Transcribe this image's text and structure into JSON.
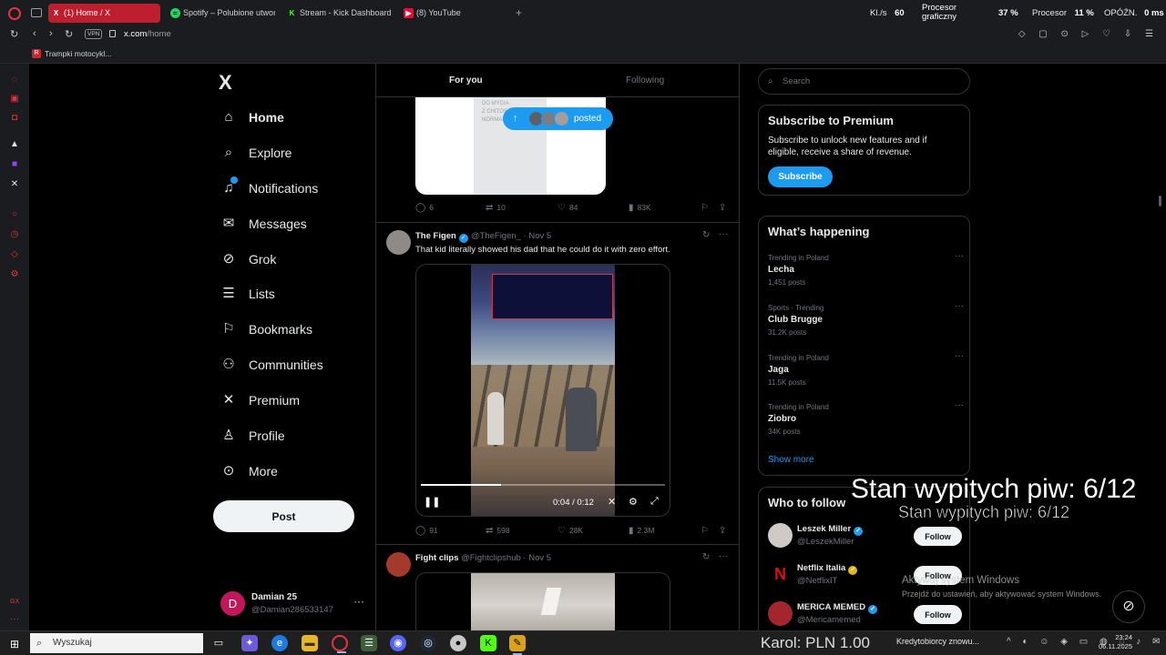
{
  "browser": {
    "tabs": [
      {
        "label": "(1) Home / X",
        "icon": "x-favicon",
        "active": true
      },
      {
        "label": "Spotify – Polubione utwory",
        "icon": "spotify-favicon",
        "active": false
      },
      {
        "label": "Stream - Kick Dashboard",
        "icon": "kick-favicon",
        "active": false
      },
      {
        "label": "(8) YouTube",
        "icon": "youtube-favicon",
        "active": false
      }
    ],
    "sys_stats": {
      "kls_label": "Kl./s",
      "kls_value": "60",
      "gpu_label_1": "Procesor",
      "gpu_label_2": "graficzny",
      "gpu_value": "37 %",
      "cpu_label": "Procesor",
      "cpu_value": "11 %",
      "lat_label": "OPÓŹN.",
      "lat_value": "0 ms"
    },
    "url_host": "x.com",
    "url_path": "/home",
    "vpn_label": "VPN",
    "bookmark": "Trampki motocykl..."
  },
  "nav": {
    "logo": "X",
    "items": [
      {
        "label": "Home",
        "icon": "home-icon"
      },
      {
        "label": "Explore",
        "icon": "search-icon"
      },
      {
        "label": "Notifications",
        "icon": "bell-icon"
      },
      {
        "label": "Messages",
        "icon": "mail-icon"
      },
      {
        "label": "Grok",
        "icon": "grok-icon"
      },
      {
        "label": "Lists",
        "icon": "list-icon"
      },
      {
        "label": "Bookmarks",
        "icon": "bookmark-icon"
      },
      {
        "label": "Communities",
        "icon": "people-icon"
      },
      {
        "label": "Premium",
        "icon": "x-icon"
      },
      {
        "label": "Profile",
        "icon": "person-icon"
      },
      {
        "label": "More",
        "icon": "more-icon"
      }
    ],
    "post_button": "Post",
    "account": {
      "initial": "D",
      "name": "Damian 25",
      "handle": "@Damian286533147"
    }
  },
  "timeline": {
    "tabs": [
      "For you",
      "Following"
    ],
    "posted_pill": "posted",
    "media1_text": "DO MYCIA\nZ CHITOSAN...\nNORMA...",
    "tweet1_stats": {
      "replies": "6",
      "reposts": "10",
      "likes": "84",
      "views": "83K"
    },
    "tweet2": {
      "name": "The Figen",
      "handle": "@TheFigen_",
      "date": "· Nov 5",
      "text": "That kid literally showed his dad that he could do it with zero effort.",
      "video_time": "0:04 / 0:12",
      "video_progress": 0.33,
      "stats": {
        "replies": "91",
        "reposts": "598",
        "likes": "28K",
        "views": "2.3M"
      }
    },
    "tweet3": {
      "name": "Fight clips",
      "handle": "@Fightclipshub",
      "date": "· Nov 5"
    }
  },
  "right": {
    "search_placeholder": "Search",
    "premium": {
      "title": "Subscribe to Premium",
      "text": "Subscribe to unlock new features and if eligible, receive a share of revenue.",
      "button": "Subscribe"
    },
    "happening": {
      "title": "What’s happening",
      "trends": [
        {
          "meta": "Trending in Poland",
          "name": "Lecha",
          "count": "1,451 posts"
        },
        {
          "meta": "Sports · Trending",
          "name": "Club Brugge",
          "count": "31.2K posts"
        },
        {
          "meta": "Trending in Poland",
          "name": "Jaga",
          "count": "11.5K posts"
        },
        {
          "meta": "Trending in Poland",
          "name": "Ziobro",
          "count": "34K posts"
        }
      ],
      "show_more": "Show more"
    },
    "who_to_follow": {
      "title": "Who to follow",
      "users": [
        {
          "name": "Leszek Miller",
          "handle": "@LeszekMiller"
        },
        {
          "name": "Netflix Italia",
          "handle": "@NetflixIT"
        },
        {
          "name": "MERICA MEMED",
          "handle": "@Mericamemed"
        }
      ],
      "follow_label": "Follow"
    }
  },
  "overlay": {
    "big": "Stan wypitych piw: 6/12",
    "small": "Stan wypitych piw: 6/12",
    "activate_title": "Aktywuj system Windows",
    "activate_sub": "Przejdź do ustawień, aby aktywować system Windows.",
    "donation": "Karol: PLN 1.00"
  },
  "taskbar": {
    "search_label": "Wyszukaj",
    "notif_text": "Kredytobiorcy znowu...",
    "time": "23:24",
    "date": "06.11.2025"
  }
}
